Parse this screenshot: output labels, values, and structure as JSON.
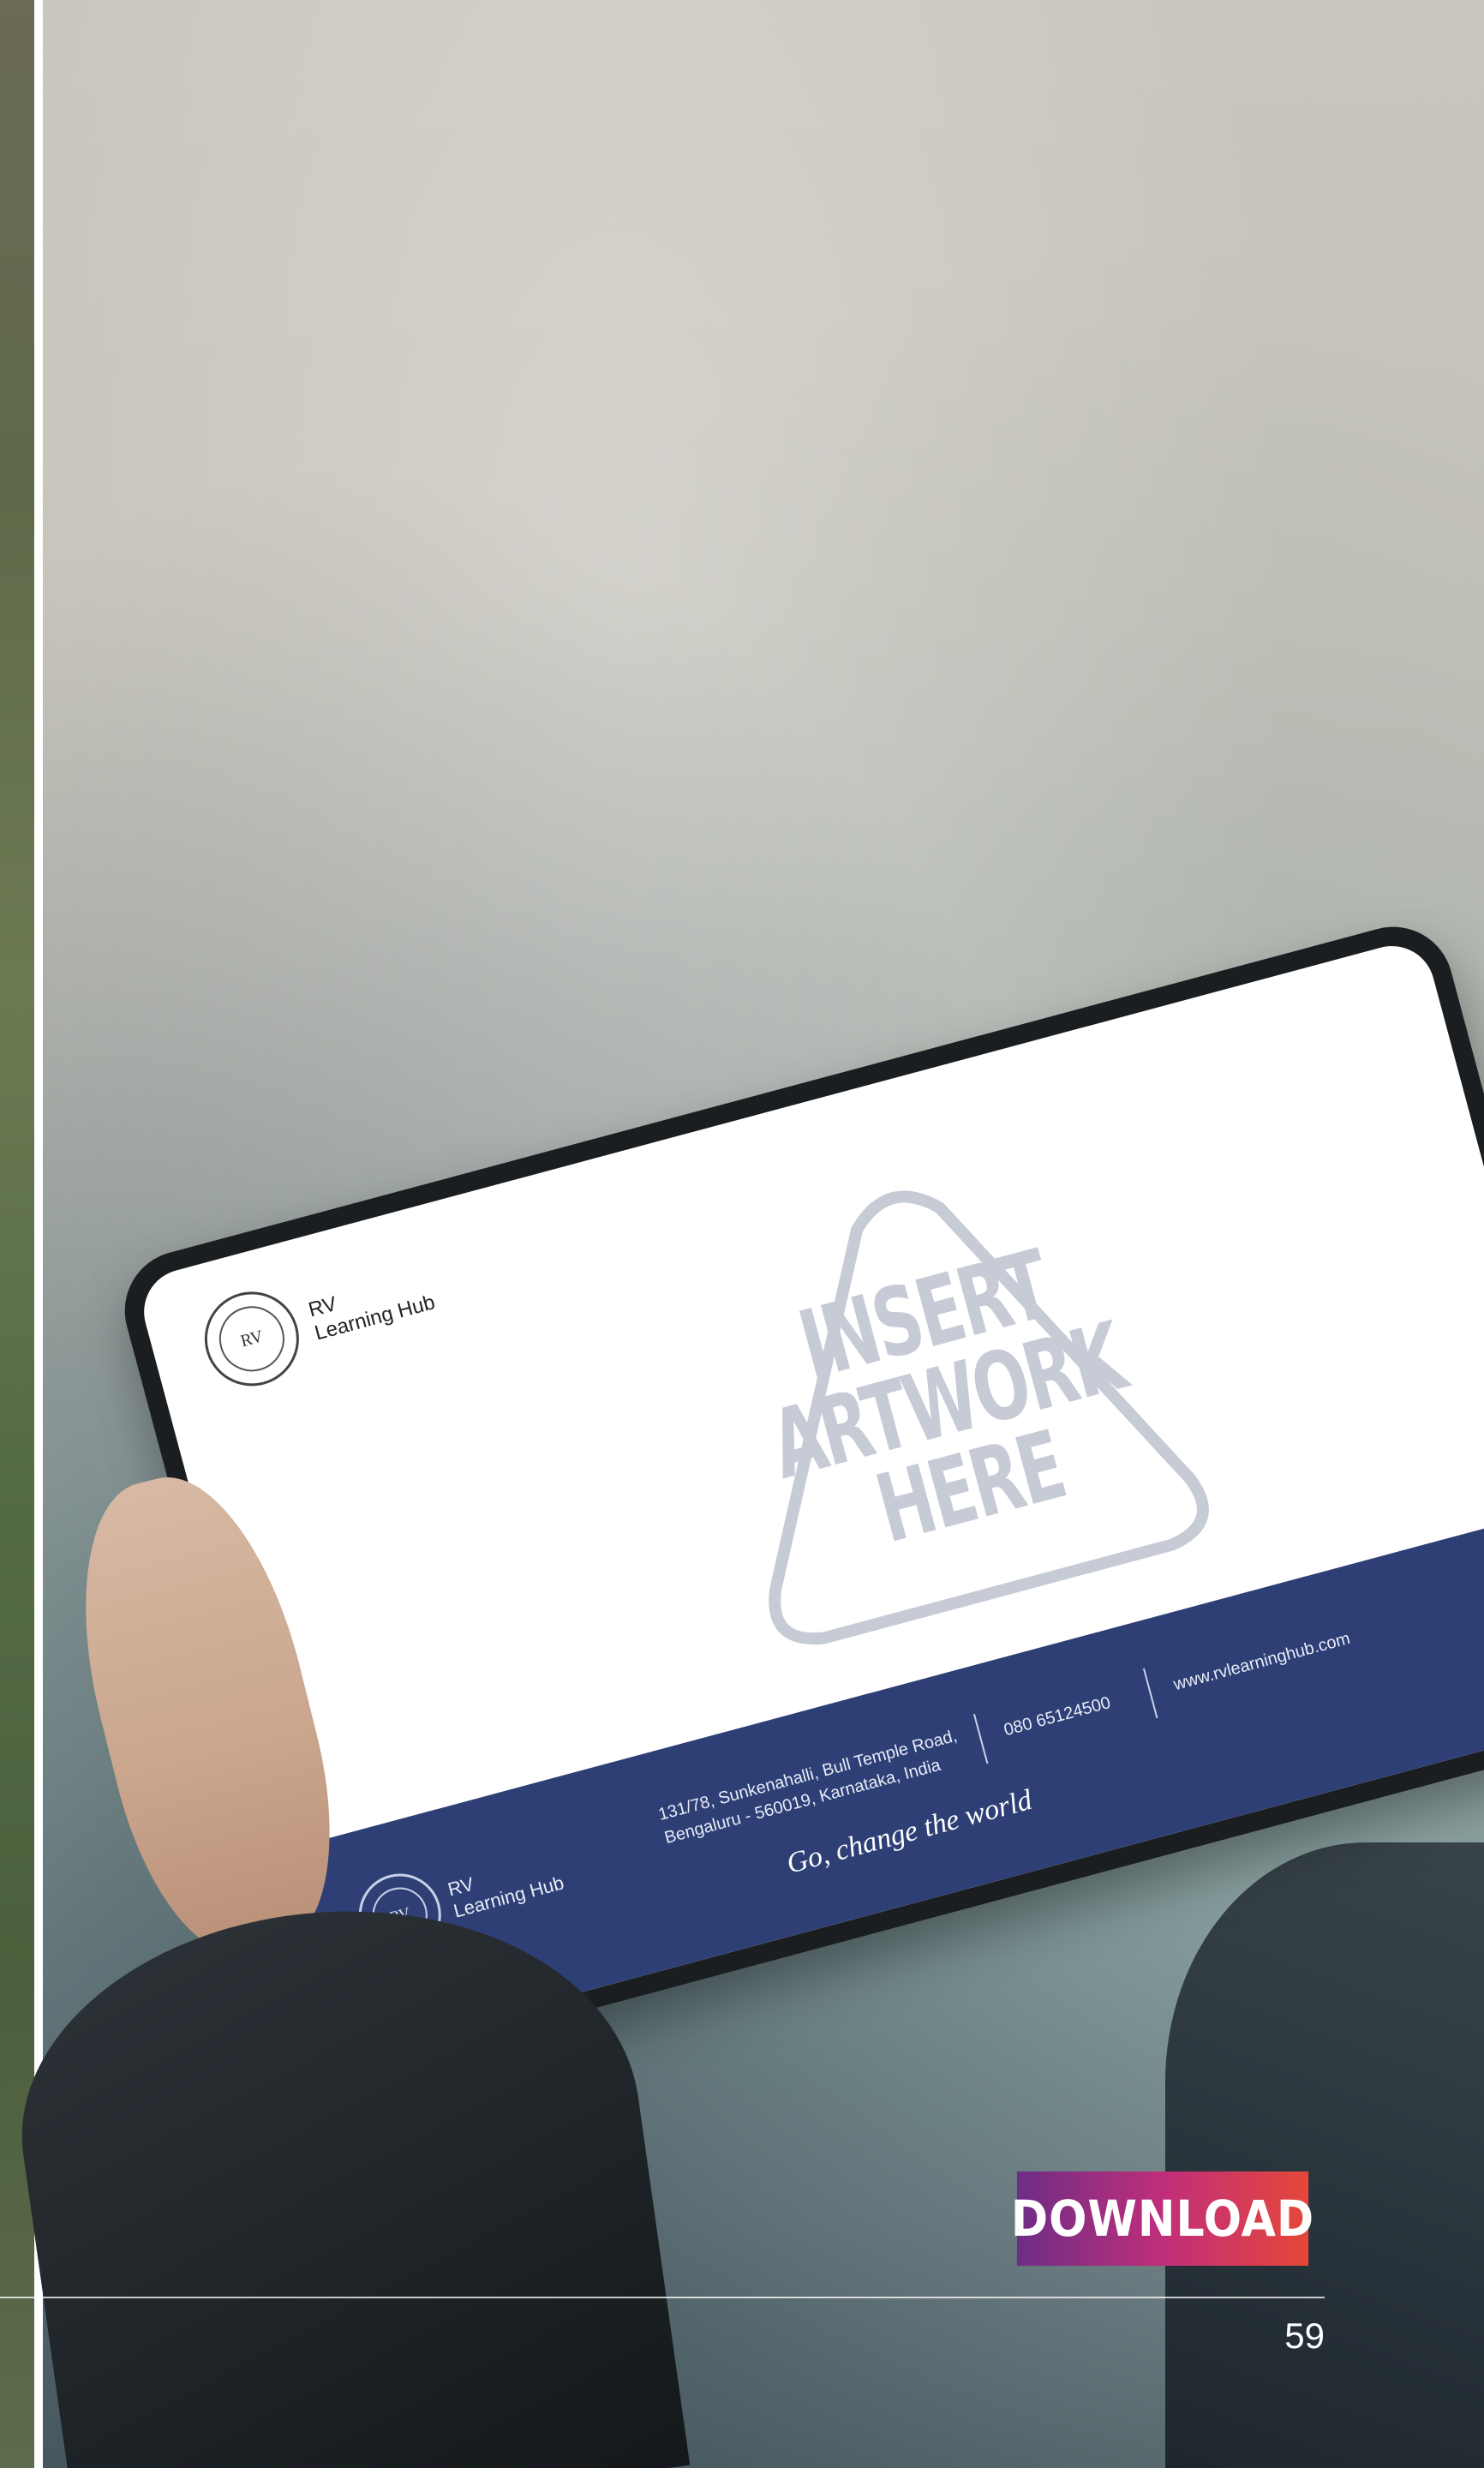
{
  "screen": {
    "brand_line1": "RV",
    "brand_line2": "Learning Hub",
    "seal_initials": "RV",
    "placeholder_line1": "INSERT",
    "placeholder_line2": "ARTWORK",
    "placeholder_line3": "HERE"
  },
  "screen_footer": {
    "brand_line1": "RV",
    "brand_line2": "Learning Hub",
    "seal_initials": "RV",
    "address_line1": "131/78, Sunkenahalli, Bull Temple Road,",
    "address_line2": "Bengaluru - 560019, Karnataka, India",
    "phone": "080 65124500",
    "website": "www.rvlearninghub.com",
    "tagline": "Go, change the world"
  },
  "download_label": "DOWNLOAD",
  "page_number": "59",
  "colors": {
    "footer_blue": "#2d3f75",
    "download_gradient_start": "#6e2d86",
    "download_gradient_end": "#e5473a"
  }
}
